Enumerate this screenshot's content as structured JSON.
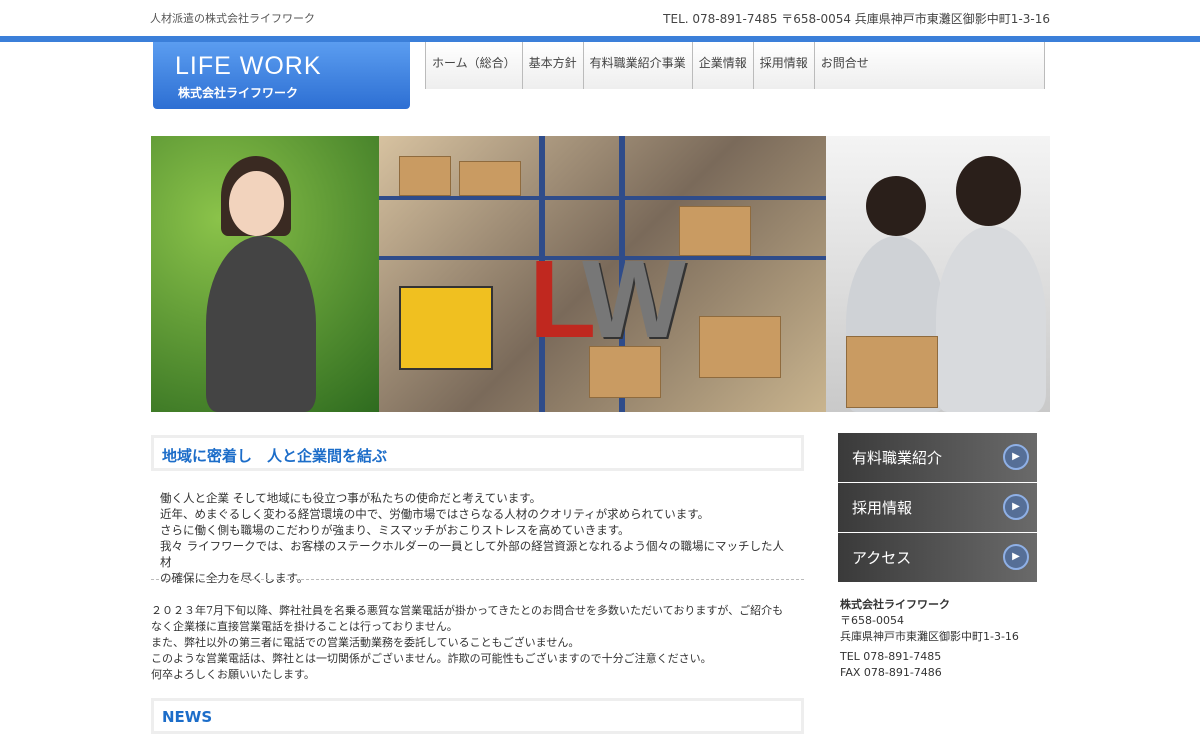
{
  "header": {
    "tagline": "人材派遣の株式会社ライフワーク",
    "contact": "TEL. 078-891-7485 〒658-0054 兵庫県神戸市東灘区御影中町1-3-16"
  },
  "logo": {
    "main": "LIFE WORK",
    "sub": "株式会社ライフワーク"
  },
  "nav": [
    "ホーム（総合）",
    "基本方針",
    "有料職業紹介事業",
    "企業情報",
    "採用情報",
    "お問合せ"
  ],
  "hero": {
    "logo_mark_l": "L",
    "logo_mark_w": "W"
  },
  "main": {
    "heading": "地域に密着し　人と企業間を結ぶ",
    "intro": [
      "働く人と企業 そして地域にも役立つ事が私たちの使命だと考えています。",
      "近年、めまぐるしく変わる経営環境の中で、労働市場ではさらなる人材のクオリティが求められています。",
      "さらに働く側も職場のこだわりが強まり、ミスマッチがおこりストレスを高めていきます。",
      "我々 ライフワークでは、お客様のステークホルダーの一員として外部の経営資源となれるよう個々の職場にマッチした人材",
      "の確保に全力を尽くします。"
    ],
    "notice": [
      "２０２３年7月下旬以降、弊社社員を名乗る悪質な営業電話が掛かってきたとのお問合せを多数いただいておりますが、ご紹介も",
      "なく企業様に直接営業電話を掛けることは行っておりません。",
      "また、弊社以外の第三者に電話での営業活動業務を委託していることもございません。",
      "このような営業電話は、弊社とは一切関係がございません。詐欺の可能性もございますので十分ご注意ください。",
      "何卒よろしくお願いいたします。"
    ],
    "news_heading": "NEWS"
  },
  "sidebar": {
    "buttons": [
      "有料職業紹介",
      "採用情報",
      "アクセス"
    ],
    "icon": "play-circle-icon"
  },
  "company": {
    "name": "株式会社ライフワーク",
    "zip": "〒658-0054",
    "address": "兵庫県神戸市東灘区御影中町1-3-16",
    "tel": "TEL 078-891-7485",
    "fax": "FAX 078-891-7486"
  }
}
